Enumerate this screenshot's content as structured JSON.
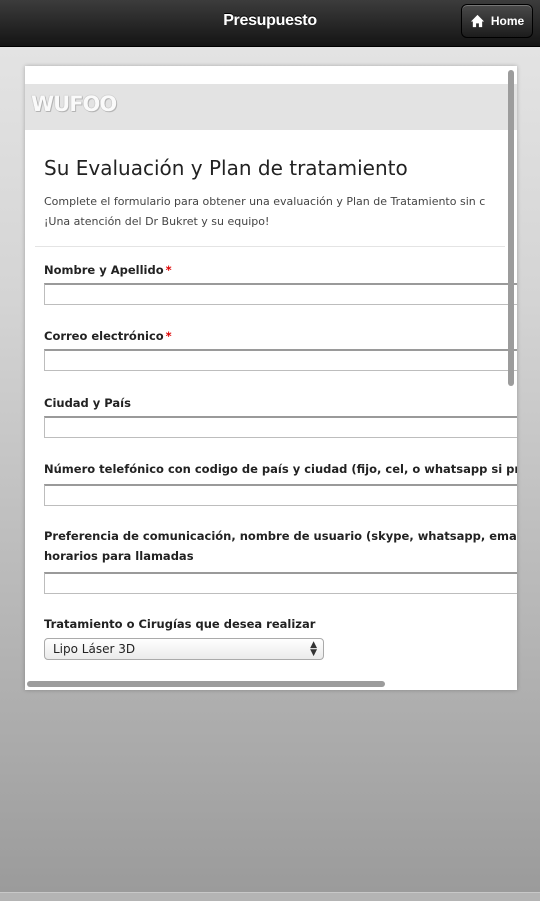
{
  "header": {
    "title": "Presupuesto",
    "home_label": "Home",
    "home_icon": "home-icon"
  },
  "form": {
    "logo_text": "WUFOO",
    "title": "Su Evaluación y Plan de tratamiento",
    "description_line1": "Complete el formulario para obtener una evaluación y Plan de Tratamiento sin c",
    "description_line2": "¡Una atención del Dr Bukret y su equipo!",
    "required_mark": "*",
    "fields": {
      "name_label": "Nombre y Apellido",
      "name_value": "",
      "email_label": "Correo electrónico",
      "email_value": "",
      "city_label": "Ciudad y País",
      "city_value": "",
      "phone_label": "Número telefónico con codigo de país y ciudad (fijo, cel, o whatsapp si pref",
      "phone_value": "",
      "contact_label_line1": "Preferencia de comunicación, nombre de usuario (skype, whatsapp, email, t",
      "contact_label_line2": "horarios para llamadas",
      "contact_value": "",
      "treatment_label": "Tratamiento o Cirugías que desea realizar",
      "treatment_selected": "Lipo Láser 3D"
    }
  },
  "colors": {
    "required": "#dd0000",
    "topbar": "#1e1e1e"
  }
}
